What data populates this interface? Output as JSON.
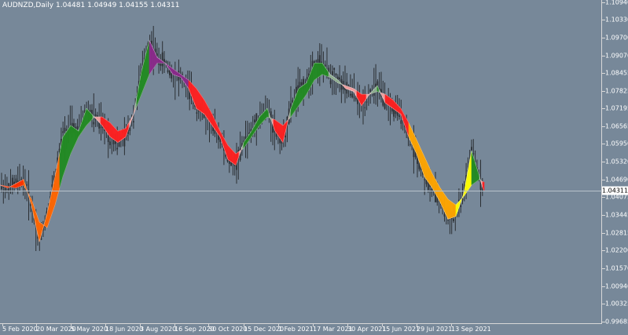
{
  "chart": {
    "title": "AUDNZD,Daily  1.04481 1.04949 1.04155 1.04311",
    "current_price": "1.04311",
    "current_price_value": 1.04311,
    "price_range": [
      0.99685,
      1.1094
    ],
    "time_range": [
      -50,
      765
    ],
    "colors": {
      "background": "#778899",
      "candles": "#2b2f33",
      "grid_line": "#b8c2cc",
      "axis_text": "#ffffff",
      "band_colors": [
        "#ff3300",
        "#ff6600",
        "#2e8b2e",
        "#228b22",
        "#8b2a8b",
        "#ff2020",
        "#f4a0a0",
        "#90b090",
        "#ffa500",
        "#ffff00"
      ]
    },
    "price_labels": [
      "1.10940",
      "1.10330",
      "1.09700",
      "1.09070",
      "1.08455",
      "1.07825",
      "1.07195",
      "1.06565",
      "1.05950",
      "1.05320",
      "1.04690",
      "1.04075",
      "1.03445",
      "1.02815",
      "1.02200",
      "1.01570",
      "1.00940",
      "1.00325",
      "0.99685"
    ],
    "time_labels": [
      "5 Feb 2020",
      "20 Mar 2020",
      "5 May 2020",
      "18 Jun 2020",
      "3 Aug 2020",
      "16 Sep 2020",
      "30 Oct 2020",
      "15 Dec 2020",
      "1 Feb 2021",
      "17 Mar 2021",
      "30 Apr 2021",
      "15 Jun 2021",
      "29 Jul 2021",
      "13 Sep 2021"
    ]
  },
  "chart_data": {
    "type": "line",
    "x": [
      0,
      10,
      20,
      30,
      40,
      50,
      60,
      70,
      80,
      90,
      100,
      110,
      120,
      130,
      140,
      150,
      160,
      170,
      180,
      190,
      200,
      210,
      220,
      230,
      240,
      250,
      260,
      270,
      280,
      290,
      300,
      310,
      320,
      330,
      340,
      350,
      360,
      370,
      380,
      390,
      400,
      410,
      420,
      430,
      440,
      450,
      460,
      470,
      480,
      490,
      500,
      510,
      520,
      530,
      540,
      550,
      560,
      570,
      580,
      590,
      600,
      610,
      615
    ],
    "series": [
      {
        "values": [
          1.045,
          1.044,
          1.0455,
          1.047,
          1.038,
          1.025,
          1.035,
          1.048,
          1.062,
          1.066,
          1.064,
          1.072,
          1.069,
          1.066,
          1.062,
          1.06,
          1.062,
          1.07,
          1.085,
          1.096,
          1.09,
          1.088,
          1.084,
          1.083,
          1.079,
          1.072,
          1.07,
          1.066,
          1.062,
          1.054,
          1.052,
          1.06,
          1.064,
          1.069,
          1.072,
          1.064,
          1.06,
          1.072,
          1.079,
          1.081,
          1.088,
          1.088,
          1.084,
          1.082,
          1.079,
          1.078,
          1.073,
          1.077,
          1.08,
          1.074,
          1.072,
          1.07,
          1.062,
          1.056,
          1.048,
          1.044,
          1.039,
          1.033,
          1.034,
          1.042,
          1.057,
          1.048,
          1.0431
        ]
      },
      {
        "values": [
          1.045,
          1.0445,
          1.044,
          1.045,
          1.04,
          1.032,
          1.03,
          1.038,
          1.048,
          1.056,
          1.062,
          1.066,
          1.069,
          1.069,
          1.067,
          1.064,
          1.065,
          1.07,
          1.077,
          1.084,
          1.088,
          1.088,
          1.086,
          1.084,
          1.082,
          1.079,
          1.075,
          1.07,
          1.064,
          1.059,
          1.056,
          1.058,
          1.062,
          1.066,
          1.069,
          1.068,
          1.066,
          1.069,
          1.073,
          1.077,
          1.082,
          1.084,
          1.083,
          1.081,
          1.08,
          1.079,
          1.077,
          1.077,
          1.078,
          1.077,
          1.075,
          1.072,
          1.067,
          1.061,
          1.055,
          1.049,
          1.044,
          1.04,
          1.038,
          1.041,
          1.045,
          1.047,
          1.046
        ]
      }
    ],
    "ylim": [
      0.99685,
      1.1094
    ]
  }
}
